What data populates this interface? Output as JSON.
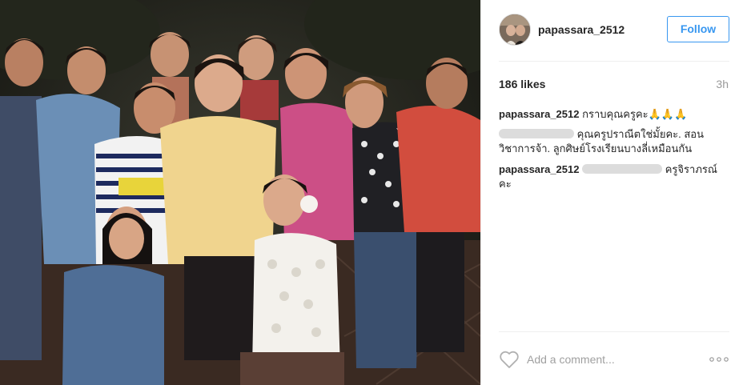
{
  "post": {
    "username": "papassara_2512",
    "follow_label": "Follow",
    "likes": "186 likes",
    "time": "3h",
    "caption": {
      "user": "papassara_2512",
      "text": "กราบคุณครูคะ🙏🙏🙏"
    },
    "comments": [
      {
        "user_hidden": "",
        "text_line1": "คุณครูปราณีตใช่มั้ยคะ. สอน",
        "text_line2": "วิชาการจ้า. ลูกศิษย์โรงเรียนบางลี่เหมือนกัน"
      },
      {
        "user": "papassara_2512",
        "text_line1": "ครูจิราภรณ์",
        "text_line2": "คะ"
      }
    ],
    "add_comment_placeholder": "Add a comment...",
    "icons": {
      "like": "heart-icon",
      "more": "more-options-icon"
    },
    "colors": {
      "accent": "#3897f0",
      "text": "#262626",
      "muted": "#999999"
    }
  }
}
